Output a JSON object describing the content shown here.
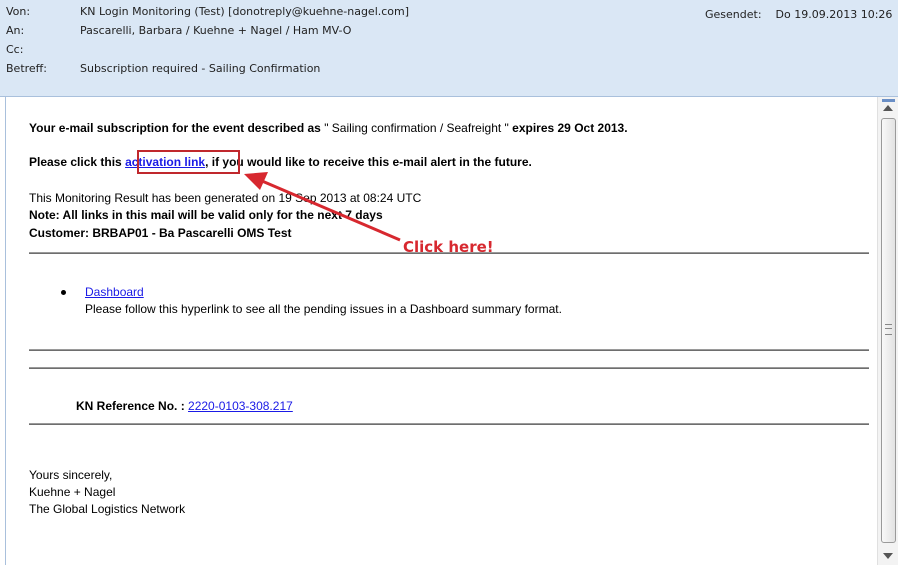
{
  "header": {
    "from_label": "Von:",
    "from_value": "KN Login Monitoring (Test) [donotreply@kuehne-nagel.com]",
    "to_label": "An:",
    "to_value": "Pascarelli, Barbara / Kuehne + Nagel / Ham MV-O",
    "cc_label": "Cc:",
    "cc_value": "",
    "subject_label": "Betreff:",
    "subject_value": "Subscription required - Sailing Confirmation",
    "sent_label": "Gesendet:",
    "sent_value": "Do 19.09.2013 10:26"
  },
  "body": {
    "line1_pre": "Your e-mail subscription for the event described as ",
    "line1_event": "\" Sailing confirmation / Seafreight \"",
    "line1_post": " expires 29 Oct 2013.",
    "line2_pre": "Please click this ",
    "line2_link": "activation link",
    "line2_post": ", if you would like to receive this e-mail alert in the future.",
    "generated": "This Monitoring Result has been generated on 19 Sep 2013 at 08:24 UTC",
    "note": "Note: All links in this mail will be valid only for the next 7 days",
    "customer": "Customer: BRBAP01 - Ba Pascarelli OMS Test",
    "dashboard_link": "Dashboard",
    "dashboard_desc": "Please follow this hyperlink to see all the pending issues in a Dashboard summary format.",
    "ref_label": "KN Reference No. : ",
    "ref_value": "2220-0103-308.217",
    "closing1": "Yours sincerely,",
    "closing2": "Kuehne + Nagel",
    "closing3": "The Global Logistics Network"
  },
  "annotation": {
    "text": "Click here!",
    "color": "#d7282f"
  }
}
